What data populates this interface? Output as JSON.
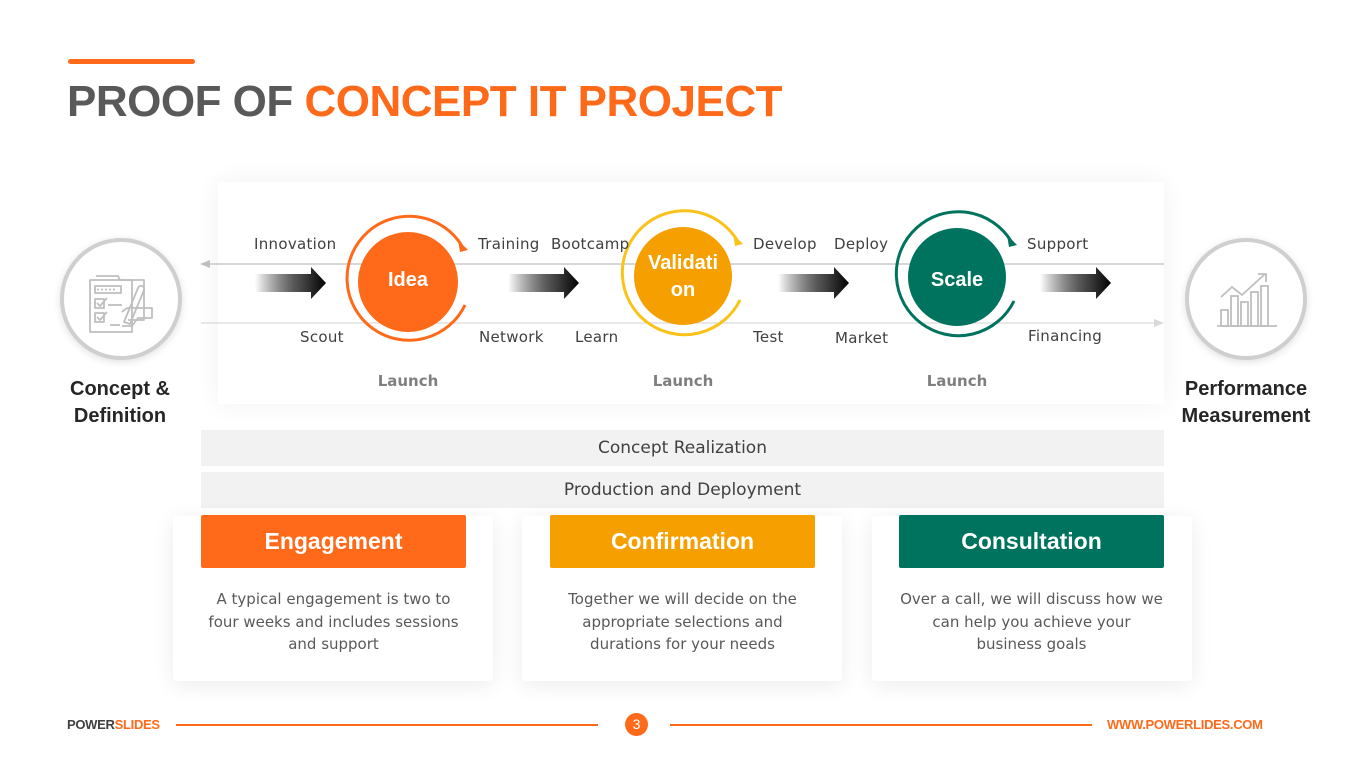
{
  "title": {
    "dark": "PROOF OF ",
    "accent": "CONCEPT IT PROJECT"
  },
  "colors": {
    "orange": "#FF6A1A",
    "yellow": "#F5A000",
    "yellow_ring": "#FBC21A",
    "green": "#00735E",
    "gray_icon": "#BFBFBF"
  },
  "left_node": {
    "icon": "checklist-signing-icon",
    "label_line1": "Concept &",
    "label_line2": "Definition"
  },
  "right_node": {
    "icon": "growth-chart-icon",
    "label_line1": "Performance",
    "label_line2": "Measurement"
  },
  "stages": [
    {
      "label_line1": "Idea",
      "label_line2": "",
      "launch": "Launch",
      "color": "#FF6A1A"
    },
    {
      "label_line1": "Validati",
      "label_line2": "on",
      "launch": "Launch",
      "color": "#F5A000"
    },
    {
      "label_line1": "Scale",
      "label_line2": "",
      "launch": "Launch",
      "color": "#00735E"
    }
  ],
  "top_words": [
    "Innovation",
    "Training",
    "Bootcamp",
    "Develop",
    "Deploy",
    "Support"
  ],
  "bottom_words": [
    "Scout",
    "Network",
    "Learn",
    "Test",
    "Market",
    "Financing"
  ],
  "bars": [
    "Concept Realization",
    "Production and Deployment"
  ],
  "cards": [
    {
      "title": "Engagement",
      "text": "A typical engagement is two to four weeks and includes sessions and support",
      "color": "#FF6A1A"
    },
    {
      "title": "Confirmation",
      "text": "Together we will decide on the appropriate selections and durations for your needs",
      "color": "#F5A000"
    },
    {
      "title": "Consultation",
      "text": "Over a call, we will discuss how we can help you achieve your business goals",
      "color": "#00735E"
    }
  ],
  "footer": {
    "brand_dark": "POWER",
    "brand_accent": "SLIDES",
    "page": "3",
    "url": "WWW.POWERLIDES.COM"
  }
}
